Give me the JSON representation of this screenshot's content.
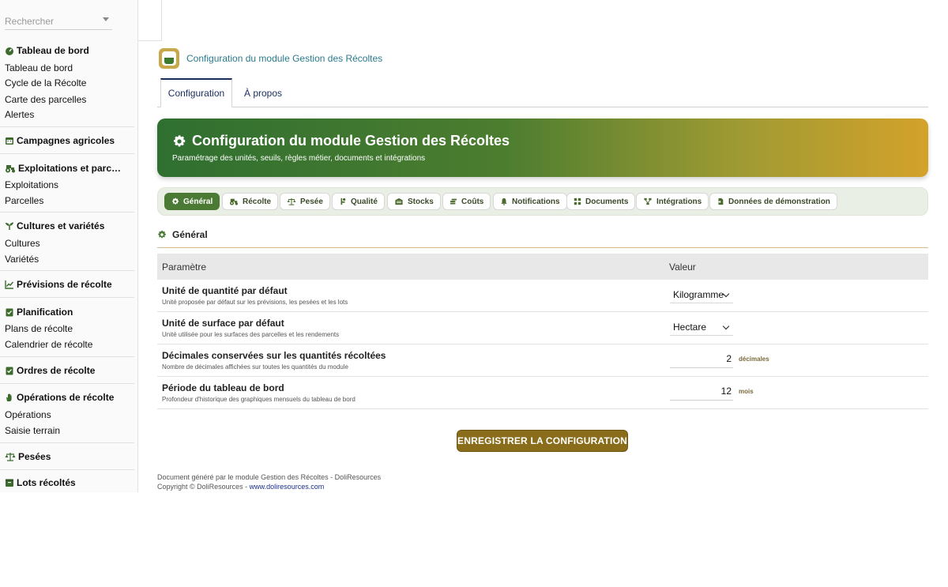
{
  "sidebar": {
    "search_placeholder": "Rechercher",
    "sections": [
      {
        "title": "Tableau de bord",
        "icon": "dashboard-icon",
        "items": [
          "Tableau de bord",
          "Cycle de la Récolte",
          "Carte des parcelles",
          "Alertes"
        ]
      },
      {
        "title": "Campagnes agricoles",
        "icon": "calendar-icon",
        "items": []
      },
      {
        "title": "Exploitations et parc…",
        "icon": "tractor-icon",
        "items": [
          "Exploitations",
          "Parcelles"
        ]
      },
      {
        "title": "Cultures et variétés",
        "icon": "seedling-icon",
        "items": [
          "Cultures",
          "Variétés"
        ]
      },
      {
        "title": "Prévisions de récolte",
        "icon": "chart-line-icon",
        "items": []
      },
      {
        "title": "Planification",
        "icon": "clipboard-check-icon",
        "items": [
          "Plans de récolte",
          "Calendrier de récolte"
        ]
      },
      {
        "title": "Ordres de récolte",
        "icon": "clipboard-check-icon",
        "items": []
      },
      {
        "title": "Opérations de récolte",
        "icon": "hand-icon",
        "items": [
          "Opérations",
          "Saisie terrain"
        ]
      },
      {
        "title": "Pesées",
        "icon": "scale-icon",
        "items": []
      },
      {
        "title": "Lots récoltés",
        "icon": "box-icon",
        "items": []
      }
    ]
  },
  "header": {
    "title": "Configuration du module Gestion des Récoltes"
  },
  "tabs": [
    {
      "label": "Configuration",
      "active": true
    },
    {
      "label": "À propos",
      "active": false
    }
  ],
  "banner": {
    "title": "Configuration du module Gestion des Récoltes",
    "subtitle": "Paramétrage des unités, seuils, règles métier, documents et intégrations"
  },
  "subtabs": [
    {
      "label": "Général",
      "icon": "gear-icon",
      "active": true
    },
    {
      "label": "Récolte",
      "icon": "tractor-icon"
    },
    {
      "label": "Pesée",
      "icon": "scale-icon"
    },
    {
      "label": "Qualité",
      "icon": "award-icon"
    },
    {
      "label": "Stocks",
      "icon": "warehouse-icon"
    },
    {
      "label": "Coûts",
      "icon": "coins-icon"
    },
    {
      "label": "Notifications",
      "icon": "bell-icon"
    },
    {
      "label": "Documents",
      "icon": "grid-icon"
    },
    {
      "label": "Intégrations",
      "icon": "network-icon"
    },
    {
      "label": "Données de démonstration",
      "icon": "file-import-icon"
    }
  ],
  "section": {
    "title": "Général"
  },
  "table": {
    "col_param": "Paramètre",
    "col_value": "Valeur",
    "rows": [
      {
        "name": "Unité de quantité par défaut",
        "desc": "Unité proposée par défaut sur les prévisions, les pesées et les lots",
        "type": "select",
        "value": "Kilogramme"
      },
      {
        "name": "Unité de surface par défaut",
        "desc": "Unité utilisée pour les surfaces des parcelles et les rendements",
        "type": "select",
        "value": "Hectare"
      },
      {
        "name": "Décimales conservées sur les quantités récoltées",
        "desc": "Nombre de décimales affichées sur toutes les quantités du module",
        "type": "number",
        "value": "2",
        "unit": "décimales"
      },
      {
        "name": "Période du tableau de bord",
        "desc": "Profondeur d'historique des graphiques mensuels du tableau de bord",
        "type": "number",
        "value": "12",
        "unit": "mois"
      }
    ]
  },
  "save_label": "ENREGISTRER LA CONFIGURATION",
  "footer": {
    "line1": "Document généré par le module Gestion des Récoltes - DoliResources",
    "line2_prefix": "Copyright © DoliResources - ",
    "link": "www.doliresources.com"
  },
  "colors": {
    "accent": "#4b7a35",
    "banner_start": "#2f6f30",
    "banner_end": "#d4a22a",
    "save_button": "#8a6d1a",
    "title_link": "#2a7a8c"
  }
}
